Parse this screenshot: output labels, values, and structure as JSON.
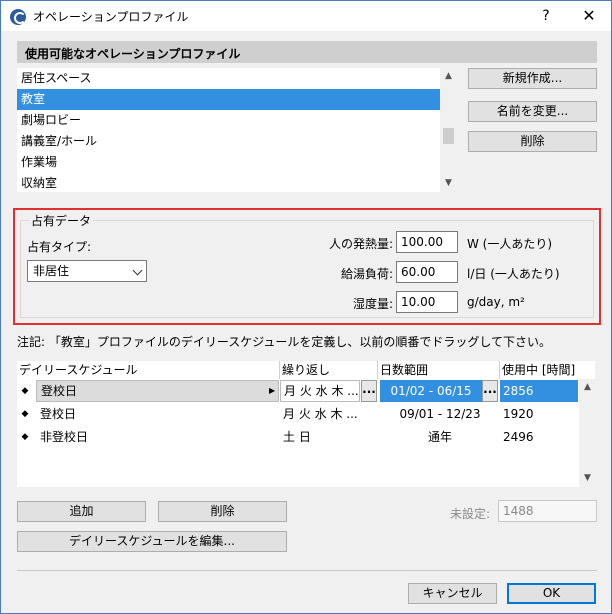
{
  "window": {
    "title": "オペレーションプロファイル",
    "help": "?",
    "close": "✕"
  },
  "profiles": {
    "header": "使用可能なオペレーションプロファイル",
    "items": [
      "居住スペース",
      "教室",
      "劇場ロビー",
      "講義室/ホール",
      "作業場",
      "収納室"
    ],
    "selected_index": 1,
    "new_button": "新規作成...",
    "rename_button": "名前を変更...",
    "delete_button": "削除"
  },
  "occupancy": {
    "group_title": "占有データ",
    "type_label": "占有タイプ:",
    "type_value": "非居住",
    "heat_label": "人の発熱量:",
    "heat_value": "100.00",
    "heat_unit": "W (一人あたり)",
    "water_label": "給湯負荷:",
    "water_value": "60.00",
    "water_unit": "l/日 (一人あたり)",
    "humidity_label": "湿度量:",
    "humidity_value": "10.00",
    "humidity_unit": "g/day, m²"
  },
  "note": "注記: 「教室」プロファイルのデイリースケジュールを定義し、以前の順番でドラッグして下さい。",
  "schedule": {
    "columns": [
      "デイリースケジュール",
      "繰り返し",
      "日数範囲",
      "使用中 [時間]"
    ],
    "rows": [
      {
        "name": "登校日",
        "repeat": "月 火 水 木 ...",
        "range": "01/02 - 06/15",
        "hours": "2856"
      },
      {
        "name": "登校日",
        "repeat": "月 火 水 木 ...",
        "range": "09/01 - 12/23",
        "hours": "1920"
      },
      {
        "name": "非登校日",
        "repeat": "土 日",
        "range": "通年",
        "hours": "2496"
      }
    ],
    "dots": "...",
    "add_button": "追加",
    "delete_button": "削除",
    "edit_button": "デイリースケジュールを編集...",
    "unset_label": "未設定:",
    "unset_value": "1488"
  },
  "footer": {
    "cancel_button": "キャンセル",
    "ok_button": "OK"
  }
}
